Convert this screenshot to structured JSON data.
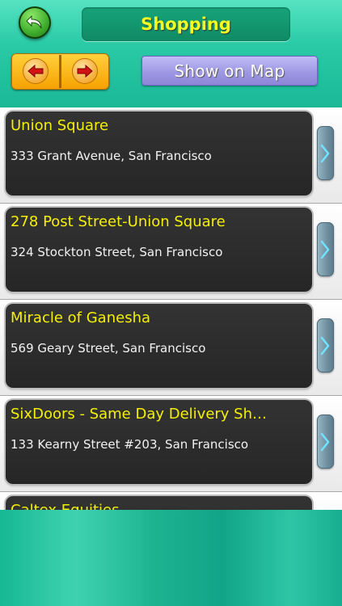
{
  "header": {
    "title": "Shopping",
    "back_icon": "back-curved-arrow-icon",
    "prev_icon": "arrow-left-icon",
    "next_icon": "arrow-right-icon",
    "map_button_label": "Show on Map"
  },
  "places": [
    {
      "name": "Union Square",
      "address": "333 Grant Avenue, San Francisco"
    },
    {
      "name": "278 Post Street-Union Square",
      "address": "324 Stockton Street, San Francisco"
    },
    {
      "name": "Miracle of Ganesha",
      "address": "569 Geary Street, San Francisco"
    },
    {
      "name": "SixDoors - Same Day Delivery Sh…",
      "address": "133 Kearny Street #203, San Francisco"
    },
    {
      "name": "Caltex Equities",
      "address": ""
    }
  ],
  "colors": {
    "title_text": "#f2ff24",
    "place_name": "#f4f000",
    "arrow_buttons": "#f5a100",
    "map_button": "#9e98e4",
    "teal_background": "#1db391"
  }
}
